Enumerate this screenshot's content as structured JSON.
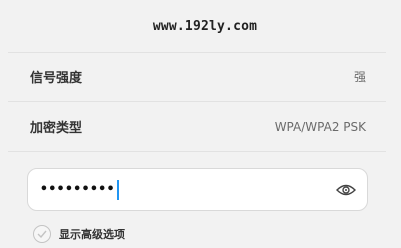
{
  "header": {
    "title": "www.192ly.com"
  },
  "rows": {
    "signal": {
      "label": "信号强度",
      "value": "强"
    },
    "security": {
      "label": "加密类型",
      "value": "WPA/WPA2 PSK"
    }
  },
  "password": {
    "value": "•••••••••",
    "toggle_icon": "eye-icon"
  },
  "advanced": {
    "label": "显示高级选项",
    "checked": false,
    "icon": "check-icon"
  },
  "colors": {
    "background": "#f2f2f2",
    "caret": "#2196f3",
    "field": "#ffffff"
  }
}
